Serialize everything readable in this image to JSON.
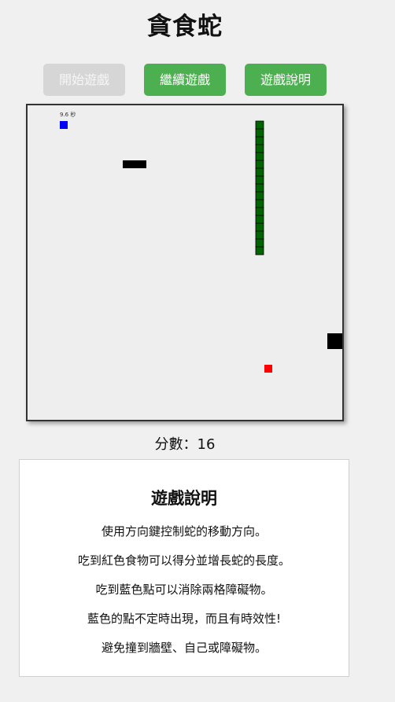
{
  "title": "貪食蛇",
  "buttons": {
    "start": "開始遊戲",
    "continue": "繼續遊戲",
    "help": "遊戲說明"
  },
  "board": {
    "timer_label": "9.6 秒",
    "colors": {
      "background": "#eeeeee",
      "snake": "#006400",
      "food": "#ff0000",
      "bonus": "#0000ff",
      "obstacle": "#000000"
    }
  },
  "score": {
    "label": "分數：16"
  },
  "instructions": {
    "heading": "遊戲說明",
    "lines": [
      "使用方向鍵控制蛇的移動方向。",
      "吃到紅色食物可以得分並增長蛇的長度。",
      "吃到藍色點可以消除兩格障礙物。",
      "藍色的點不定時出現，而且有時效性!",
      "避免撞到牆壁、自己或障礙物。"
    ]
  }
}
